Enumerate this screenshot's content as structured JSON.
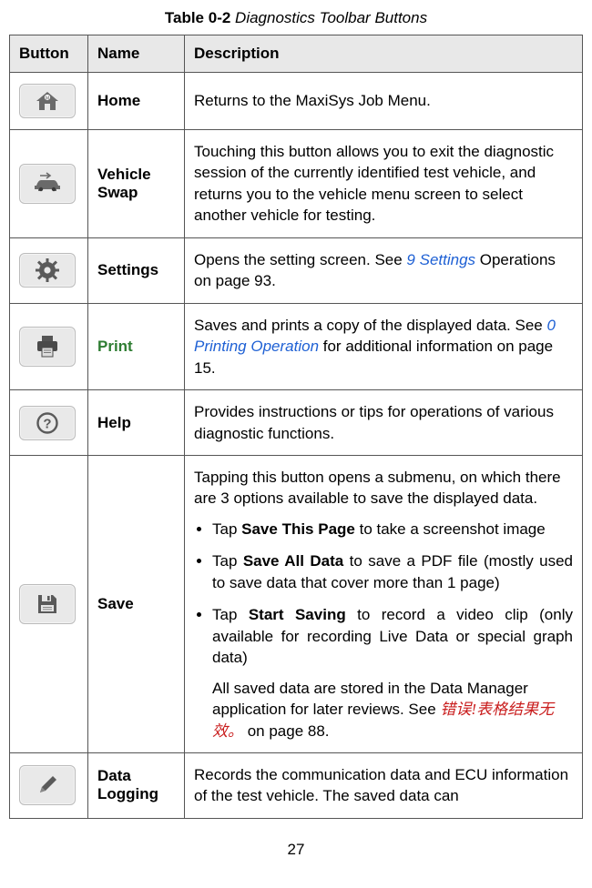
{
  "caption": {
    "label": "Table 0-2",
    "title": "Diagnostics Toolbar Buttons"
  },
  "headers": {
    "button": "Button",
    "name": "Name",
    "description": "Description"
  },
  "rows": {
    "home": {
      "name": "Home",
      "desc": "Returns to the MaxiSys Job Menu."
    },
    "vehicle_swap": {
      "name": "Vehicle Swap",
      "desc": "Touching this button allows you to exit the diagnostic session of the currently identified test vehicle, and returns you to the vehicle menu screen to select another vehicle for testing."
    },
    "settings": {
      "name": "Settings",
      "d_pre": "Opens the setting screen. See ",
      "d_ref": "9 Settings",
      "d_post": " Operations on page 93."
    },
    "print": {
      "name": "Print",
      "d_pre": "Saves and prints a copy of the displayed data. See ",
      "d_ref": "0 Printing Operation",
      "d_post": " for additional information on page 15."
    },
    "help": {
      "name": "Help",
      "desc": "Provides instructions or tips for operations of various diagnostic functions."
    },
    "save": {
      "name": "Save",
      "intro": "Tapping this button opens a submenu, on which there are 3 options available to save the displayed data.",
      "b1_pre": "Tap ",
      "b1_btn": "Save This Page",
      "b1_post": " to take a screenshot image",
      "b2_pre": "Tap ",
      "b2_btn": "Save All Data",
      "b2_post": " to save a PDF file (mostly used to save data that cover more than 1 page)",
      "b3_pre": "Tap ",
      "b3_btn": "Start Saving",
      "b3_post": " to record a video clip (only available for recording Live Data or special graph data)",
      "after_pre": "All saved data are stored in the Data Manager application for later reviews. See ",
      "after_err": "错误!表格结果无效。",
      "after_post": " on page 88."
    },
    "data_logging": {
      "name": "Data Logging",
      "desc": "Records the communication data and ECU information of the test vehicle. The saved data can"
    }
  },
  "page_number": "27"
}
